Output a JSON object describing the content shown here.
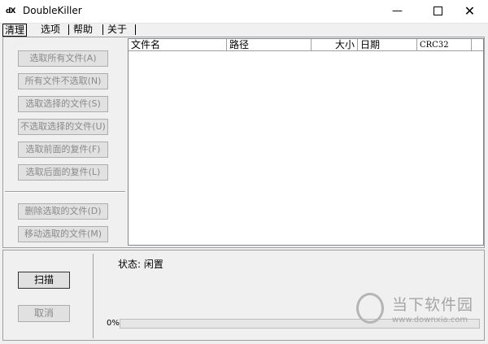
{
  "window": {
    "title": "DoubleKiller",
    "icon_text": "dX",
    "minimize_glyph": "—",
    "close_glyph": "✕"
  },
  "menu": {
    "tabs": [
      "清理",
      "选项",
      "帮助",
      "关于"
    ]
  },
  "sidebar": {
    "buttons": [
      "选取所有文件(A)",
      "所有文件不选取(N)",
      "选取选择的文件(S)",
      "不选取选择的文件(U)",
      "选取前面的复件(F)",
      "选取后面的复件(L)",
      "删除选取的文件(D)",
      "移动选取的文件(M)"
    ]
  },
  "filelist": {
    "columns": [
      "文件名",
      "路径",
      "大小",
      "日期",
      "CRC32"
    ]
  },
  "actions": {
    "scan": "扫描",
    "cancel": "取消"
  },
  "status": {
    "text": "状态: 闲置",
    "progress_label": "0%",
    "progress": 0
  },
  "watermark": {
    "text": "当下软件园",
    "url": "www.downxia.com"
  },
  "colors": {
    "progress_fill": "#06b025",
    "disabled_text": "#8a8a8a"
  }
}
